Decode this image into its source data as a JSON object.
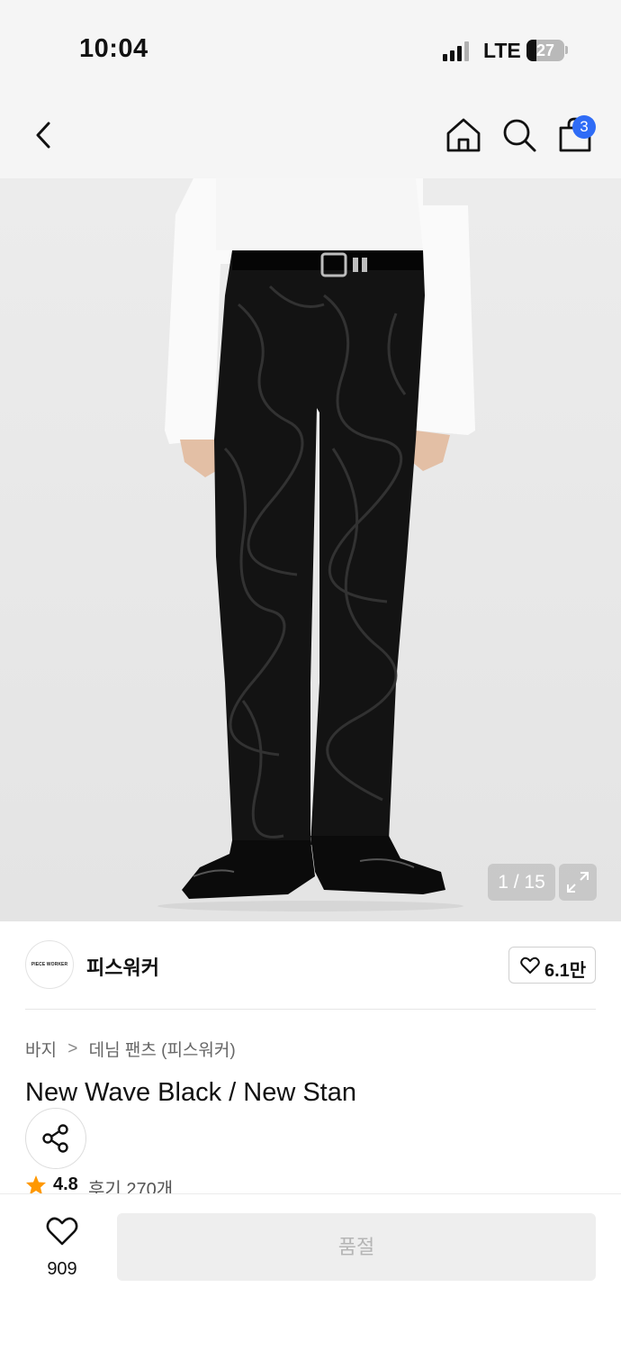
{
  "status_bar": {
    "time": "10:04",
    "network": "LTE",
    "battery": "27"
  },
  "nav": {
    "cart_count": "3",
    "icons": [
      "back-icon",
      "home-icon",
      "search-icon",
      "bag-icon"
    ]
  },
  "gallery": {
    "indicator": "1 / 15"
  },
  "brand": {
    "logo_text": "PIECE WORKER",
    "name": "피스워커",
    "likes": "6.1만"
  },
  "breadcrumb": {
    "category": "바지",
    "separator": ">",
    "subcategory": "데님 팬츠 (피스워커)"
  },
  "product": {
    "title": "New Wave Black / New Stan",
    "rating": "4.8",
    "reviews": "후기 270개"
  },
  "bottom": {
    "wish_count": "909",
    "action_label": "품절"
  },
  "colors": {
    "accent": "#2f6cf6",
    "star": "#ff9800",
    "disabled_bg": "#eeeeee"
  }
}
